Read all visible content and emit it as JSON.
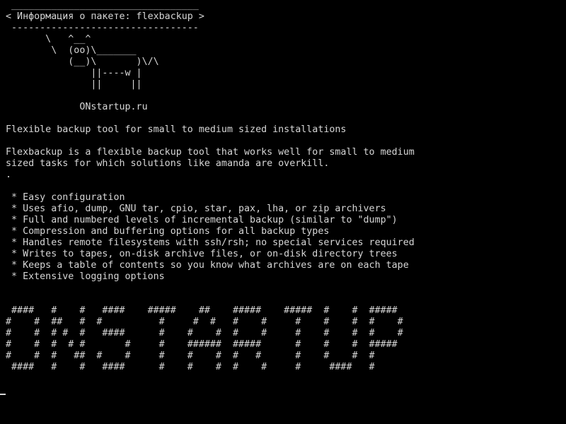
{
  "terminal": {
    "banner": {
      "rule_top": " _________________________________",
      "title": "< Информация о пакете: flexbackup >",
      "rule_bottom": " ---------------------------------"
    },
    "cow": [
      "       \\   ^__^",
      "        \\  (oo)\\_______",
      "           (__)\\       )\\/\\",
      "               ||----w |",
      "               ||     ||"
    ],
    "site": "             ONstartup.ru",
    "summary": "Flexible backup tool for small to medium sized installations",
    "description": [
      "Flexbackup is a flexible backup tool that works well for small to medium",
      "sized tasks for which solutions like amanda are overkill.",
      "."
    ],
    "features": [
      " * Easy configuration",
      " * Uses afio, dump, GNU tar, cpio, star, pax, lha, or zip archivers",
      " * Full and numbered levels of incremental backup (similar to \"dump\")",
      " * Compression and buffering options for all backup types",
      " * Handles remote filesystems with ssh/rsh; no special services required",
      " * Writes to tapes, on-disk archive files, or on-disk directory trees",
      " * Keeps a table of contents so you know what archives are on each tape",
      " * Extensive logging options"
    ],
    "ascii_art": [
      " ####   #    #   ####    #####    ##    #####    #####  #    #  #####",
      "#    #  ##   #  #          #     #  #   #    #     #    #    #  #    #",
      "#    #  # #  #   ####      #    #    #  #    #     #    #    #  #    #",
      "#    #  #  # #       #     #    ######  #####      #    #    #  #####",
      "#    #  #   ##  #    #     #    #    #  #   #      #    #    #  #",
      " ####   #    #   ####      #    #    #  #    #     #     ####   #"
    ]
  }
}
